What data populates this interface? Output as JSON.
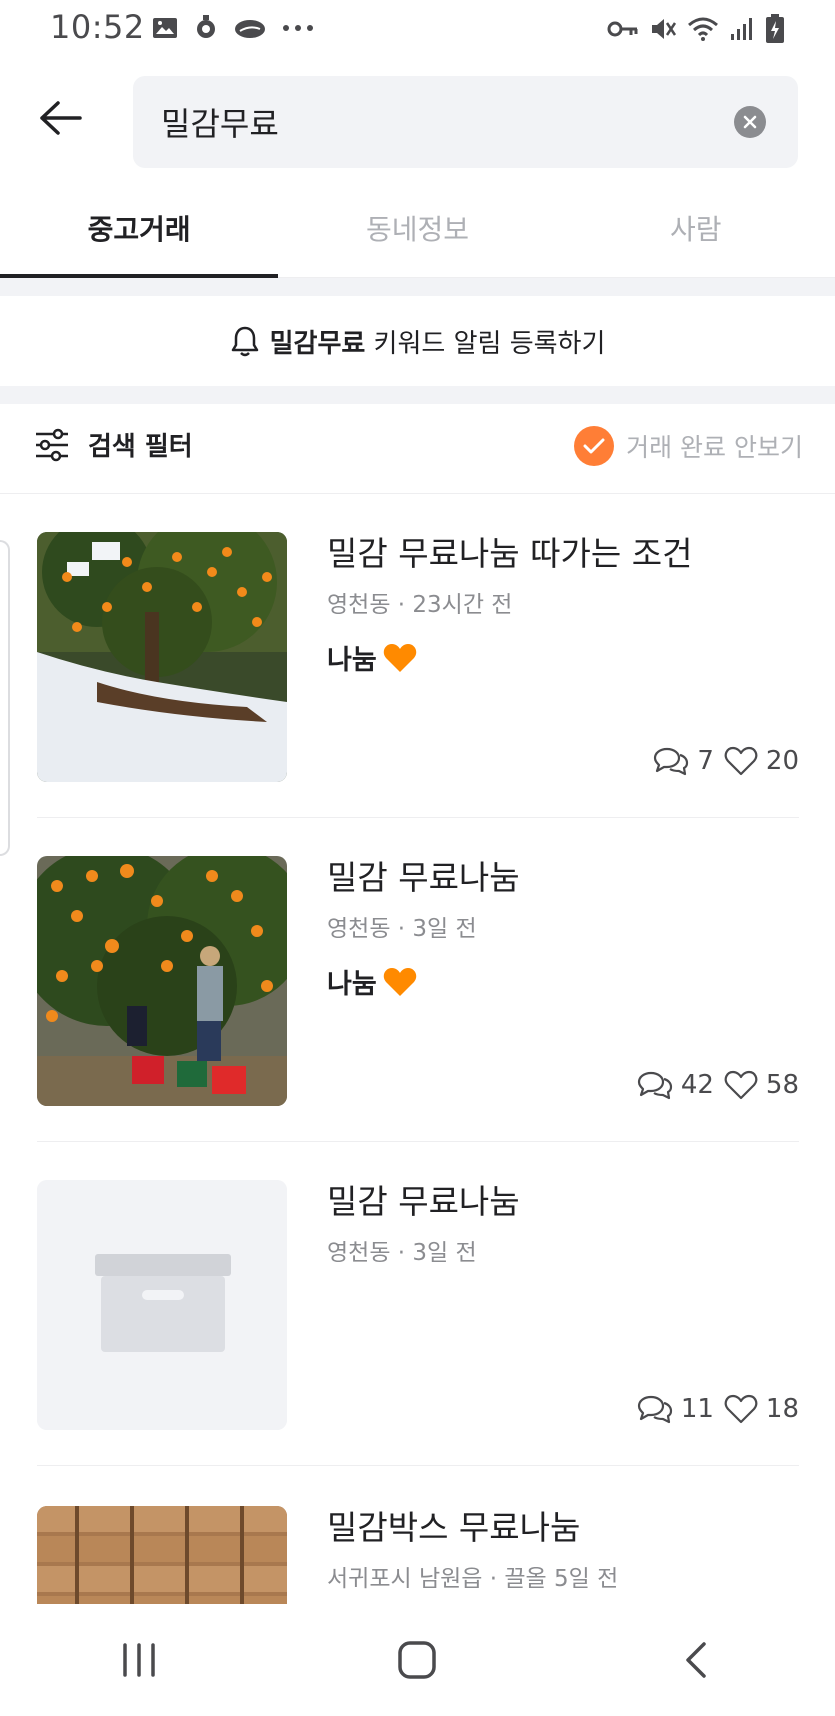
{
  "status_bar": {
    "time": "10:52",
    "left_icons": [
      "image-icon",
      "location-pin-icon",
      "cloud-icon",
      "more-dots-icon"
    ],
    "right_icons": [
      "key-icon",
      "mute-icon",
      "wifi-icon",
      "signal-icon",
      "battery-charging-icon"
    ]
  },
  "search": {
    "value": "밀감무료"
  },
  "tabs": [
    {
      "label": "중고거래",
      "active": true
    },
    {
      "label": "동네정보",
      "active": false
    },
    {
      "label": "사람",
      "active": false
    }
  ],
  "alarm": {
    "keyword": "밀감무료",
    "suffix": " 키워드 알림 등록하기"
  },
  "filter": {
    "label": "검색 필터",
    "hide_completed_label": "거래 완료 안보기",
    "hide_completed_checked": true
  },
  "colors": {
    "accent": "#ff7e36",
    "heart": "#ff8a00"
  },
  "items": [
    {
      "title": "밀감 무료나눔 따가는 조건",
      "meta": "영천동 · 23시간 전",
      "price": "나눔",
      "chats": "7",
      "likes": "20",
      "thumb": "orange-tree-snow"
    },
    {
      "title": "밀감 무료나눔",
      "meta": "영천동 · 3일 전",
      "price": "나눔",
      "chats": "42",
      "likes": "58",
      "thumb": "orange-tree-harvest"
    },
    {
      "title": "밀감 무료나눔",
      "meta": "영천동 · 3일 전",
      "price": "",
      "chats": "11",
      "likes": "18",
      "thumb": "placeholder-box"
    },
    {
      "title": "밀감박스 무료나눔",
      "meta": "서귀포시 남원읍 · 끌올 5일 전",
      "price": "",
      "chats": "",
      "likes": "",
      "thumb": "wooden-crates"
    }
  ],
  "nav": [
    "recent-apps-icon",
    "home-icon",
    "back-icon"
  ]
}
